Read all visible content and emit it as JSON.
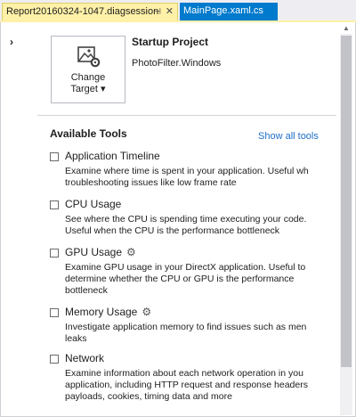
{
  "tabs": {
    "active": "Report20160324-1047.diagsession",
    "pin_icon": "pin-icon",
    "close_icon": "close-icon",
    "inactive": "MainPage.xaml.cs"
  },
  "target": {
    "button_label_line1": "Change",
    "button_label_line2": "Target",
    "dropdown_glyph": "▾",
    "icon": "image-gear-icon"
  },
  "startup": {
    "title": "Startup Project",
    "project": "PhotoFilter.Windows"
  },
  "tools": {
    "header": "Available Tools",
    "show_all": "Show all tools",
    "items": [
      {
        "name": "Application Timeline",
        "checked": false,
        "gear": false,
        "description": "Examine where time is spent in your application. Useful wh\ntroubleshooting issues like low frame rate"
      },
      {
        "name": "CPU Usage",
        "checked": false,
        "gear": false,
        "description": "See where the CPU is spending time executing your code.\nUseful when the CPU is the performance bottleneck"
      },
      {
        "name": "GPU Usage",
        "checked": false,
        "gear": true,
        "description": "Examine GPU usage in your DirectX application. Useful to\ndetermine whether the CPU or GPU is the performance\nbottleneck"
      },
      {
        "name": "Memory Usage",
        "checked": false,
        "gear": true,
        "description": "Investigate application memory to find issues such as men\nleaks"
      },
      {
        "name": "Network",
        "checked": false,
        "gear": false,
        "description": "Examine information about each network operation in you\napplication, including HTTP request and response headers\npayloads, cookies, timing data and more"
      }
    ]
  }
}
